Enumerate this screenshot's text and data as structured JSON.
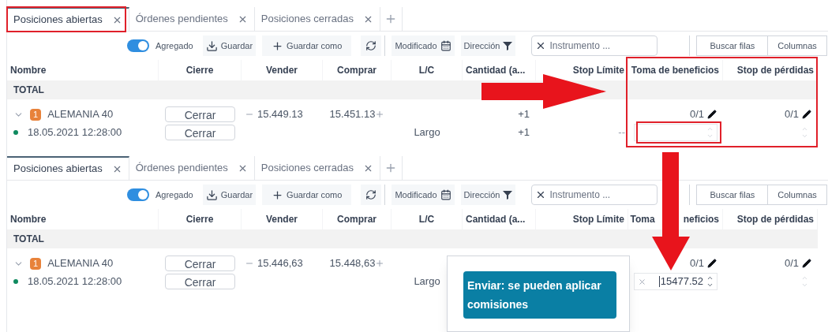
{
  "panels": [
    {
      "tabs": [
        {
          "label": "Posiciones abiertas",
          "selected": true
        },
        {
          "label": "Órdenes pendientes",
          "selected": false
        },
        {
          "label": "Posiciones cerradas",
          "selected": false
        }
      ],
      "toolbar": {
        "aggregate": {
          "label": "Agregado",
          "on": true
        },
        "save": "Guardar",
        "save_as": "Guardar como",
        "modified": "Modificado",
        "direction": "Dirección",
        "search": {
          "placeholder": "Instrumento ..."
        },
        "find_rows": "Buscar filas",
        "columns": "Columnas"
      },
      "columns": [
        {
          "parts": [
            "Nombre"
          ]
        },
        {
          "parts": [
            "Cierre"
          ]
        },
        {
          "parts": [
            "Vender"
          ]
        },
        {
          "parts": [
            "Comprar"
          ]
        },
        {
          "parts": [
            "L/C"
          ]
        },
        {
          "parts": [
            "Cantidad (a..."
          ]
        },
        {
          "parts": [
            "Stop Límite"
          ]
        },
        {
          "parts": [
            "Toma de beneficios"
          ]
        },
        {
          "parts": [
            "Stop de pérdidas"
          ]
        }
      ],
      "total_label": "TOTAL",
      "rows": [
        {
          "kind": "instrument",
          "expanded": true,
          "count": "1",
          "name": "ALEMANIA 40",
          "close": "Cerrar",
          "sell": "15.449.13",
          "buy": "15.451.13",
          "quantity": "+1",
          "take_profit": "0/1",
          "stop_loss": "0/1"
        },
        {
          "kind": "position",
          "color": "#0f8a5f",
          "time": "18.05.2021 12:28:00",
          "close": "Cerrar",
          "side": "Largo",
          "quantity": "+1",
          "stop_limit": "--",
          "take_profit_input": {}
        }
      ]
    },
    {
      "tabs": [
        {
          "label": "Posiciones abiertas",
          "selected": true
        },
        {
          "label": "Órdenes pendientes",
          "selected": false
        },
        {
          "label": "Posiciones cerradas",
          "selected": false
        }
      ],
      "toolbar": {
        "aggregate": {
          "label": "Agregado",
          "on": true
        },
        "save": "Guardar",
        "save_as": "Guardar como",
        "modified": "Modificado",
        "direction": "Dirección",
        "search": {
          "placeholder": "Instrumento ..."
        },
        "find_rows": "Buscar filas",
        "columns": "Columnas"
      },
      "columns": [
        {
          "parts": [
            "Nombre"
          ]
        },
        {
          "parts": [
            "Cierre"
          ]
        },
        {
          "parts": [
            "Vender"
          ]
        },
        {
          "parts": [
            "Comprar"
          ]
        },
        {
          "parts": [
            "L/C"
          ]
        },
        {
          "parts": [
            "Cantidad (a..."
          ]
        },
        {
          "parts": [
            "Stop Límite"
          ]
        },
        {
          "parts": [
            "Toma",
            "neficios"
          ]
        },
        {
          "parts": [
            "Stop de pérdidas"
          ]
        }
      ],
      "total_label": "TOTAL",
      "rows": [
        {
          "kind": "instrument",
          "expanded": true,
          "count": "1",
          "name": "ALEMANIA 40",
          "close": "Cerrar",
          "sell": "15.446,63",
          "buy": "15.448,63",
          "take_profit": "0/1",
          "stop_loss": "0/1"
        },
        {
          "kind": "position",
          "color": "#0f8a5f",
          "time": "18.05.2021 12:28:00",
          "close": "Cerrar",
          "side": "Largo",
          "take_profit_input": {
            "value": "15477.52"
          }
        }
      ],
      "popup": {
        "button": "Enviar: se pueden aplicar comisiones"
      }
    }
  ],
  "annotations": [
    {
      "kind": "tab-box"
    },
    {
      "kind": "columns-box"
    },
    {
      "kind": "input-box"
    },
    {
      "kind": "arrow-right"
    },
    {
      "kind": "arrow-down"
    }
  ]
}
